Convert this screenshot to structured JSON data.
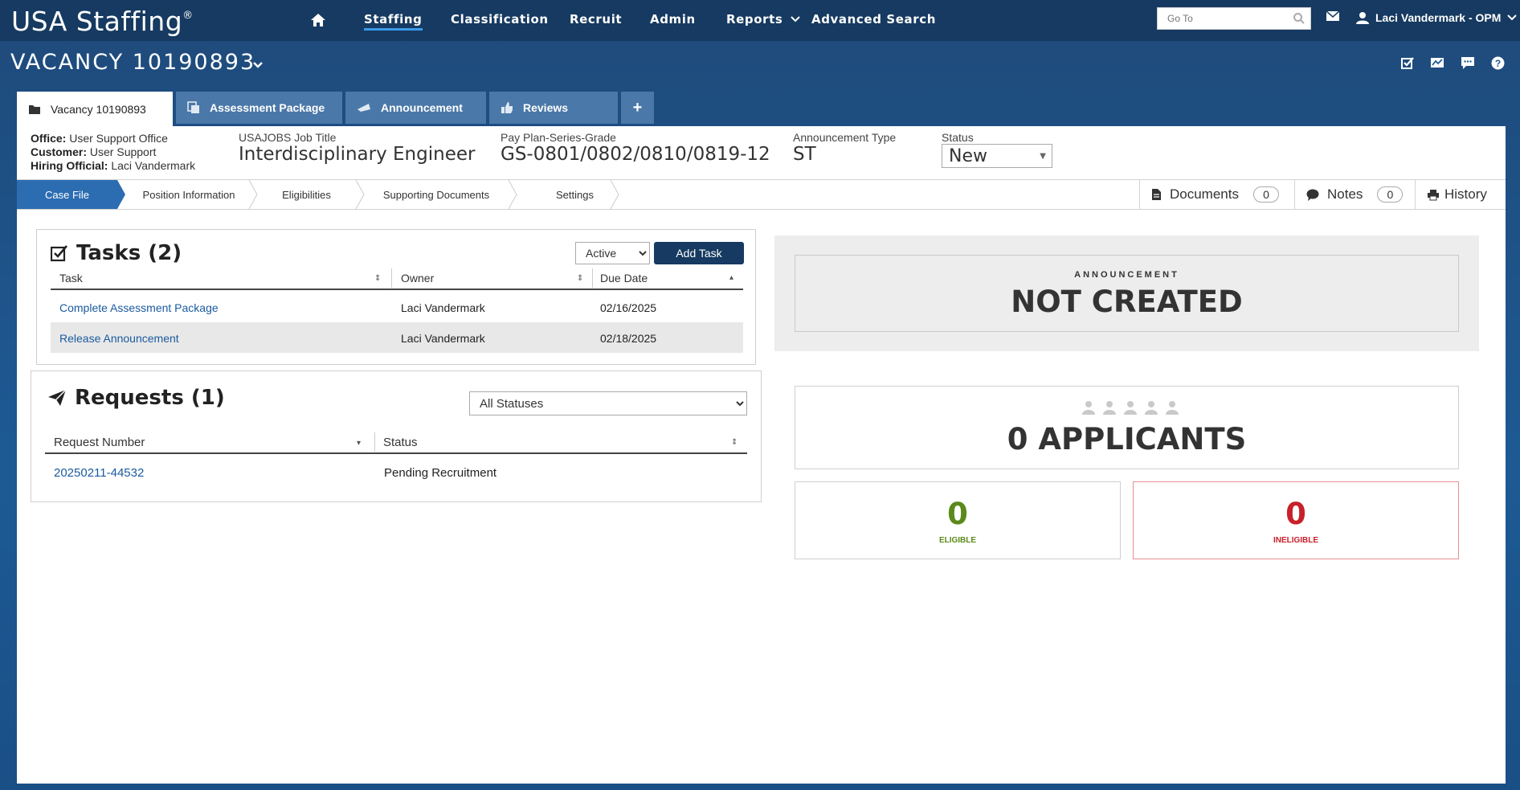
{
  "app": {
    "logo": "USA Staffing",
    "logo_mark": "®"
  },
  "nav": {
    "items": [
      "Staffing",
      "Classification",
      "Recruit",
      "Admin",
      "Reports",
      "Advanced Search"
    ],
    "active": "Staffing"
  },
  "search": {
    "placeholder": "Go To"
  },
  "user": {
    "name": "Laci Vandermark - OPM"
  },
  "vacancy": {
    "title": "VACANCY 10190893"
  },
  "tabs": [
    {
      "label": "Vacancy 10190893",
      "icon": "folder-icon"
    },
    {
      "label": "Assessment Package",
      "icon": "copy-icon"
    },
    {
      "label": "Announcement",
      "icon": "megaphone-icon"
    },
    {
      "label": "Reviews",
      "icon": "thumbs-up-icon"
    },
    {
      "label": "+",
      "icon": "plus-icon"
    }
  ],
  "meta": {
    "office_label": "Office:",
    "office": "User Support Office",
    "customer_label": "Customer:",
    "customer": "User Support",
    "hiring_label": "Hiring Official:",
    "hiring": "Laci Vandermark"
  },
  "fields": {
    "job_title_cap": "USAJOBS Job Title",
    "job_title": "Interdisciplinary Engineer",
    "pay_cap": "Pay Plan-Series-Grade",
    "pay": "GS-0801/0802/0810/0819-12",
    "ann_type_cap": "Announcement Type",
    "ann_type": "ST",
    "status_cap": "Status",
    "status": "New"
  },
  "subnav": {
    "crumbs": [
      "Case File",
      "Position Information",
      "Eligibilities",
      "Supporting Documents",
      "Settings"
    ],
    "documents_label": "Documents",
    "documents_count": "0",
    "notes_label": "Notes",
    "notes_count": "0",
    "history_label": "History"
  },
  "tasks": {
    "title": "Tasks (2)",
    "filter": "Active",
    "add_button": "Add Task",
    "headers": [
      "Task",
      "Owner",
      "Due Date"
    ],
    "rows": [
      {
        "task": "Complete Assessment Package",
        "owner": "Laci Vandermark",
        "due": "02/16/2025"
      },
      {
        "task": "Release Announcement",
        "owner": "Laci Vandermark",
        "due": "02/18/2025"
      }
    ]
  },
  "requests": {
    "title": "Requests (1)",
    "filter": "All Statuses",
    "headers": [
      "Request Number",
      "Status"
    ],
    "rows": [
      {
        "number": "20250211-44532",
        "status": "Pending Recruitment"
      }
    ]
  },
  "announcement": {
    "label": "ANNOUNCEMENT",
    "status": "NOT CREATED"
  },
  "applicants": {
    "total": "0 APPLICANTS",
    "eligible_count": "0",
    "eligible_label": "ELIGIBLE",
    "ineligible_count": "0",
    "ineligible_label": "INELIGIBLE"
  },
  "colors": {
    "nav_bg": "#163a61",
    "accent": "#2c6db2",
    "eligible": "#5a8a1a",
    "ineligible": "#c8202a",
    "link": "#1b5aa0"
  }
}
